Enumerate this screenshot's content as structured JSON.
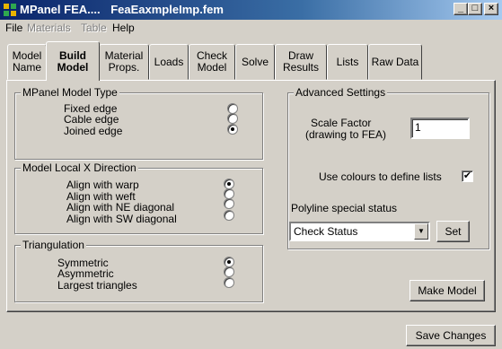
{
  "window": {
    "app_title": "MPanel FEA....",
    "file_title": "FeaEaxmpleImp.fem",
    "minimize_glyph": "_",
    "maximize_glyph": "□",
    "close_glyph": "×"
  },
  "menu": [
    "File",
    "Materials",
    "Table",
    "Help"
  ],
  "tabs": [
    {
      "label": "Model\nName"
    },
    {
      "label": "Build\nModel",
      "active": true
    },
    {
      "label": "Material\nProps."
    },
    {
      "label": "Loads"
    },
    {
      "label": "Check\nModel"
    },
    {
      "label": "Solve"
    },
    {
      "label": "Draw\nResults"
    },
    {
      "label": "Lists"
    },
    {
      "label": "Raw Data"
    }
  ],
  "model_type": {
    "title": "MPanel Model Type",
    "options": [
      {
        "label": "Fixed edge",
        "checked": false
      },
      {
        "label": "Cable edge",
        "checked": false
      },
      {
        "label": "Joined edge",
        "checked": true
      }
    ]
  },
  "local_x": {
    "title": "Model Local X Direction",
    "options": [
      {
        "label": "Align with warp",
        "checked": true
      },
      {
        "label": "Align with weft",
        "checked": false
      },
      {
        "label": "Align with  NE diagonal",
        "checked": false
      },
      {
        "label": "Align with  SW diagonal",
        "checked": false
      }
    ]
  },
  "triangulation": {
    "title": "Triangulation",
    "options": [
      {
        "label": "Symmetric",
        "checked": true
      },
      {
        "label": "Asymmetric",
        "checked": false
      },
      {
        "label": "Largest triangles",
        "checked": false
      }
    ]
  },
  "advanced": {
    "title": "Advanced Settings",
    "scale_factor_label_1": "Scale Factor",
    "scale_factor_label_2": "(drawing to FEA)",
    "scale_factor_value": "1",
    "use_colours_label": "Use colours to define lists",
    "use_colours_checked": true,
    "check_mark": "✔",
    "polyline_label": "Polyline special status",
    "polyline_value": "Check Status",
    "dropdown_arrow": "▼",
    "set_button": "Set"
  },
  "make_model_button": "Make Model",
  "save_changes_button": "Save Changes"
}
